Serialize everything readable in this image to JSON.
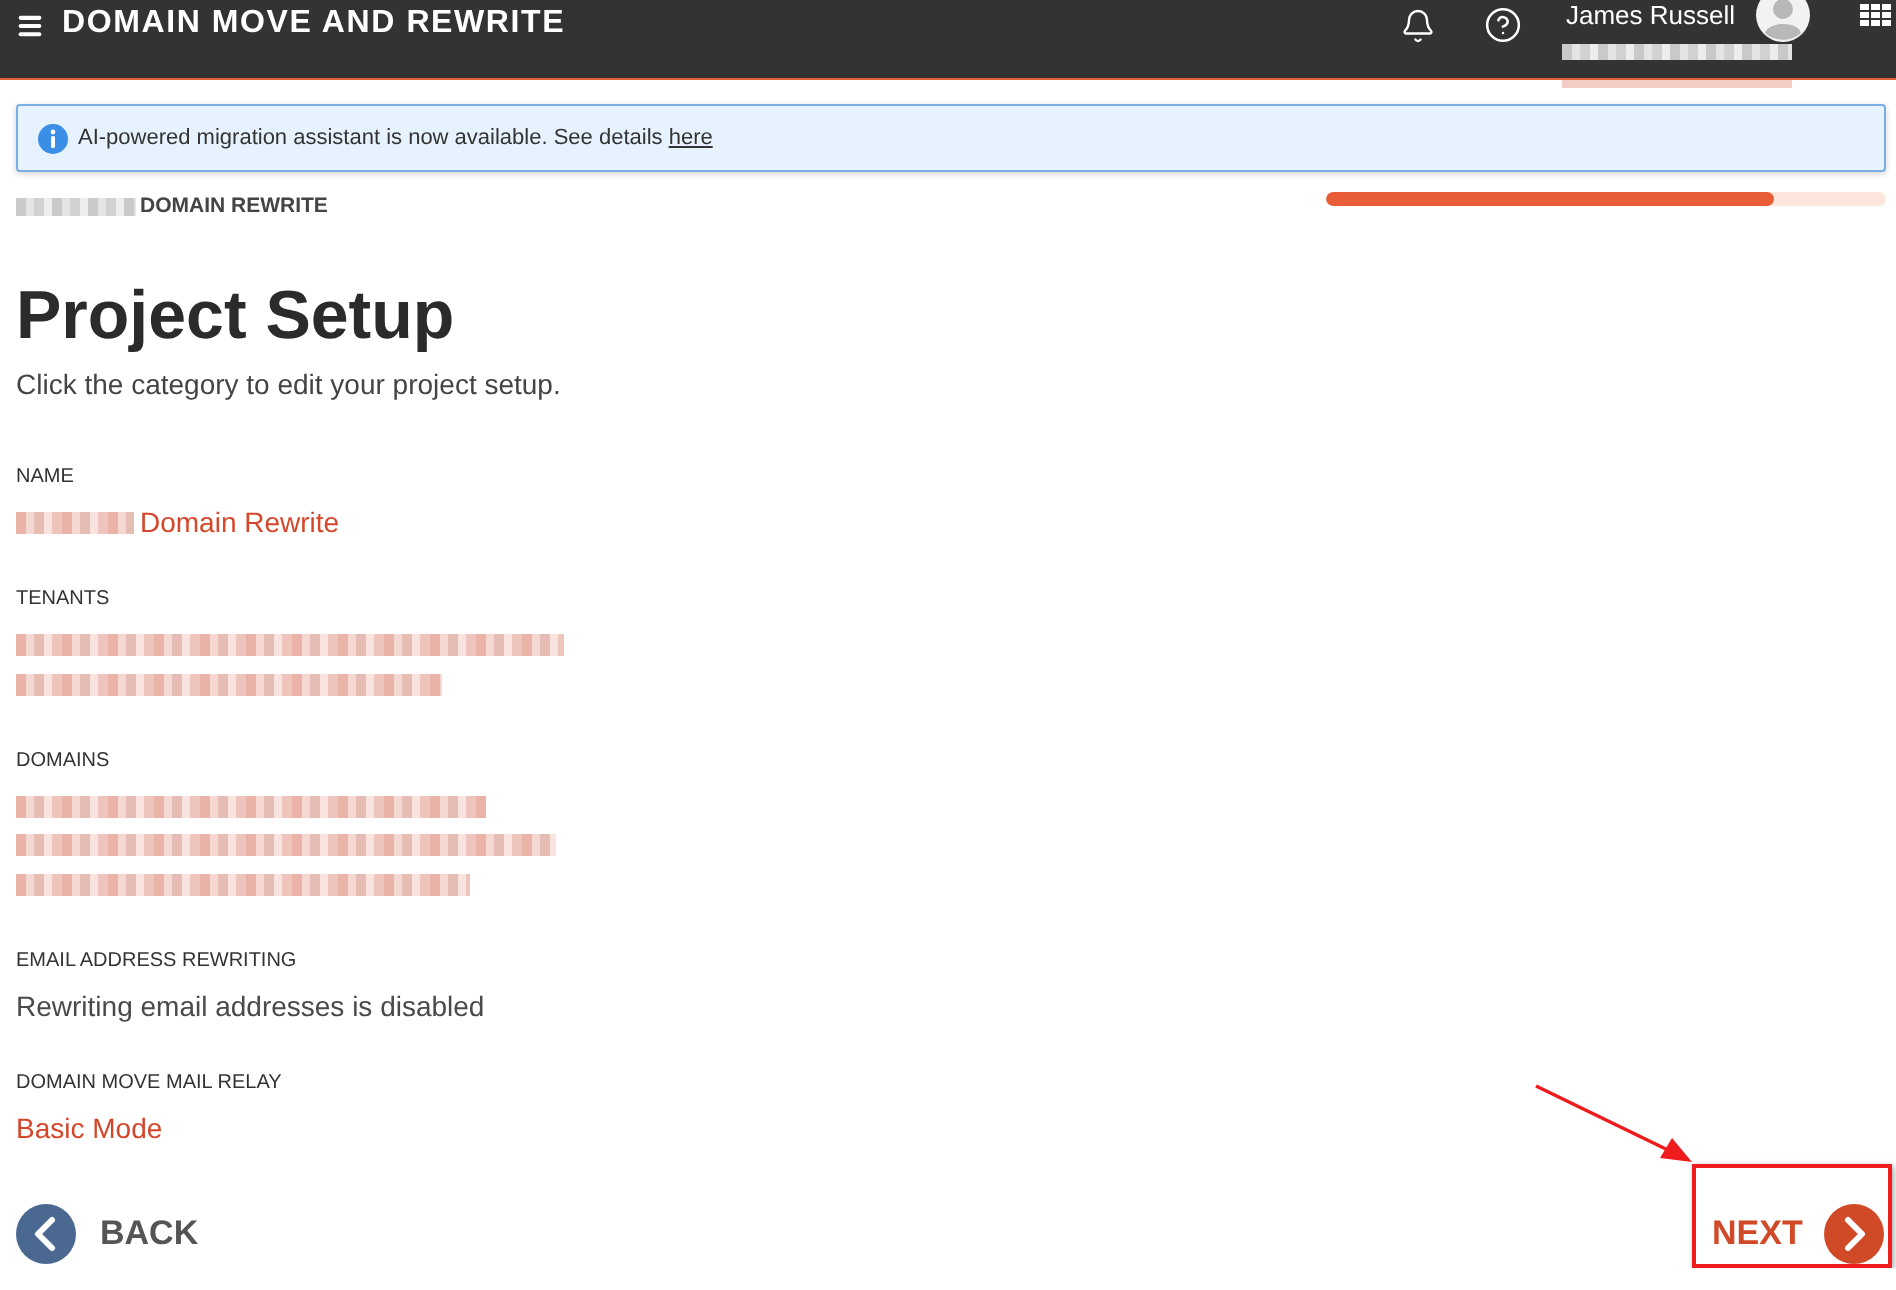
{
  "app_bar": {
    "title": "DOMAIN MOVE AND REWRITE",
    "user": {
      "name": "James Russell",
      "email_redacted": true
    }
  },
  "banner": {
    "text": "AI-powered migration assistant is now available. See details",
    "link": "here"
  },
  "breadcrumb": {
    "prefix_redacted": true,
    "text": "DOMAIN REWRITE"
  },
  "progress": {
    "level": 0.8
  },
  "page": {
    "title": "Project Setup",
    "subtitle": "Click the category to edit your project setup."
  },
  "fields": [
    {
      "label": "NAME",
      "kind": "link",
      "lines": [
        {
          "redacted": true,
          "text": "Domain Rewrite"
        }
      ]
    },
    {
      "label": "TENANTS",
      "kind": "link",
      "lines": [
        {
          "redacted": true
        },
        {
          "redacted": true
        }
      ]
    },
    {
      "label": "DOMAINS",
      "kind": "link",
      "lines": [
        {
          "redacted": true
        },
        {
          "redacted": true
        },
        {
          "redacted": true
        }
      ]
    },
    {
      "label": "EMAIL ADDRESS REWRITING",
      "kind": "plain",
      "lines": [
        {
          "redacted": false,
          "text": "Rewriting email addresses is disabled"
        }
      ]
    },
    {
      "label": "DOMAIN MOVE MAIL RELAY",
      "kind": "link",
      "lines": [
        {
          "redacted": false,
          "text": "Basic Mode"
        }
      ]
    }
  ],
  "nav": {
    "back": {
      "label": "BACK"
    },
    "next": {
      "label": "NEXT",
      "highlighted": true
    }
  }
}
